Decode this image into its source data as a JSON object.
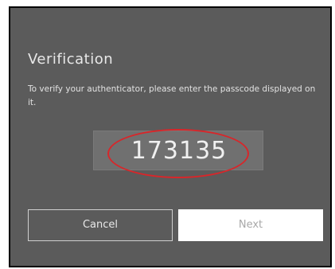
{
  "dialog": {
    "title": "Verification",
    "description": "To verify your authenticator, please enter the passcode displayed on it.",
    "passcode": "173135"
  },
  "buttons": {
    "cancel_label": "Cancel",
    "next_label": "Next"
  },
  "colors": {
    "background": "#5b5b5b",
    "highlight_circle": "#d8262a",
    "next_button_bg": "#ffffff"
  }
}
